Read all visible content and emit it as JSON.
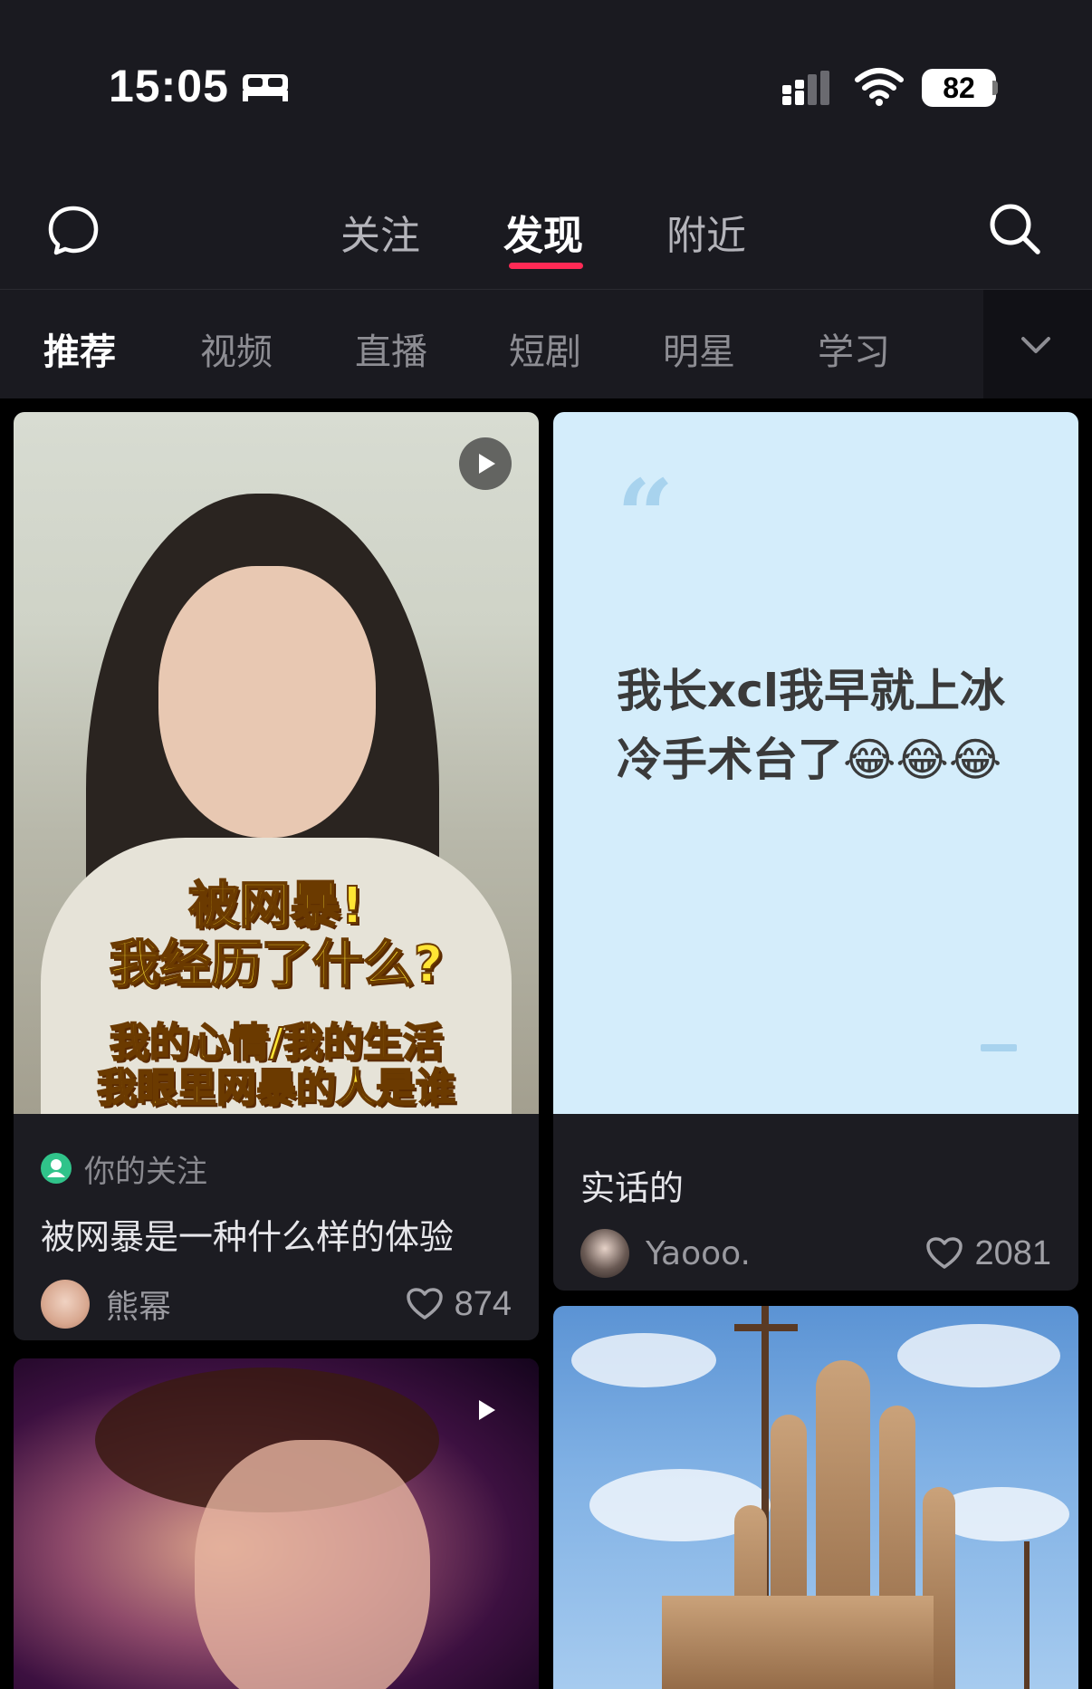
{
  "status_bar": {
    "time": "15:05",
    "battery": "82"
  },
  "top_nav": {
    "tabs": [
      {
        "label": "关注",
        "active": false
      },
      {
        "label": "发现",
        "active": true
      },
      {
        "label": "附近",
        "active": false
      }
    ],
    "accent_color": "#ff2a55"
  },
  "categories": [
    {
      "label": "推荐",
      "active": true
    },
    {
      "label": "视频",
      "active": false
    },
    {
      "label": "直播",
      "active": false
    },
    {
      "label": "短剧",
      "active": false
    },
    {
      "label": "明星",
      "active": false
    },
    {
      "label": "学习",
      "active": false
    }
  ],
  "feed": [
    {
      "type": "video",
      "overlay_lines": [
        "被网暴!",
        "我经历了什么?",
        "我的心情/我的生活",
        "我眼里网暴的人是谁"
      ],
      "follow_tag": "你的关注",
      "title": "被网暴是一种什么样的体验",
      "author": "熊幂",
      "likes": "874"
    },
    {
      "type": "text",
      "quote": "我长xcl我早就上冰冷手术台了😂😂😂",
      "title": "实话的",
      "author": "Yaooo.",
      "likes": "2081"
    },
    {
      "type": "video"
    },
    {
      "type": "image"
    }
  ]
}
